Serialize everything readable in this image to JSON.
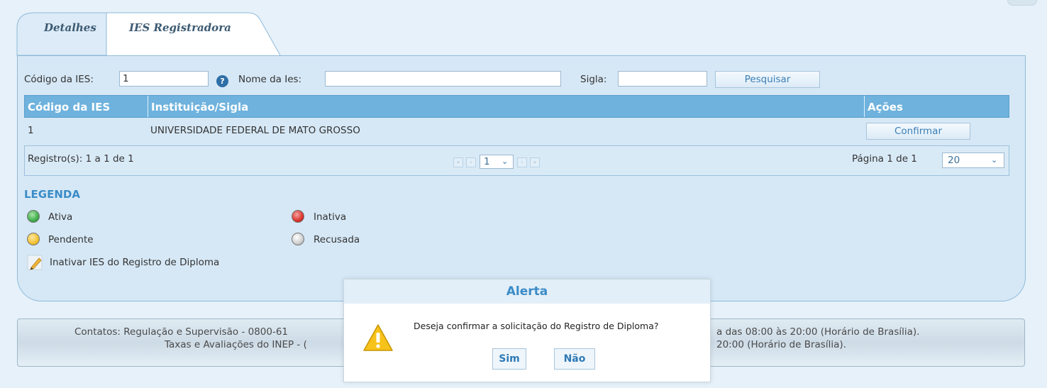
{
  "tabs": {
    "detalhes": "Detalhes",
    "ies_registradora": "IES Registradora"
  },
  "search": {
    "codigo_label": "Código da IES:",
    "codigo_value": "1",
    "nome_label": "Nome da Ies:",
    "nome_value": "",
    "sigla_label": "Sigla:",
    "sigla_value": "",
    "search_button": "Pesquisar"
  },
  "grid": {
    "headers": [
      "Código da IES",
      "Instituição/Sigla",
      "Ações"
    ],
    "rows": [
      {
        "codigo": "1",
        "instituicao": "UNIVERSIDADE FEDERAL DE MATO GROSSO",
        "acao": "Confirmar"
      }
    ]
  },
  "pager": {
    "registros": "Registro(s): 1 a 1 de 1",
    "page_select": "1",
    "pagina": "Página 1 de 1",
    "page_size": "20"
  },
  "legend": {
    "title": "LEGENDA",
    "ativa": "Ativa",
    "inativa": "Inativa",
    "pendente": "Pendente",
    "recusada": "Recusada",
    "inativar": "Inativar IES do Registro de Diploma",
    "colors": {
      "ativa": "#3fae49",
      "inativa": "#d9342b",
      "pendente": "#f2c230",
      "recusada": "#cfcfcf"
    }
  },
  "footer": {
    "line1_left": "Contatos: Regulação e Supervisão - 0800-61",
    "line1_right": "a das 08:00 às 20:00 (Horário de Brasília).",
    "line2_left": "Taxas e Avaliações do INEP - (",
    "line2_right": "20:00 (Horário de Brasília)."
  },
  "dialog": {
    "title": "Alerta",
    "message": "Deseja confirmar a solicitação do Registro de Diploma?",
    "yes": "Sim",
    "no": "Não"
  }
}
